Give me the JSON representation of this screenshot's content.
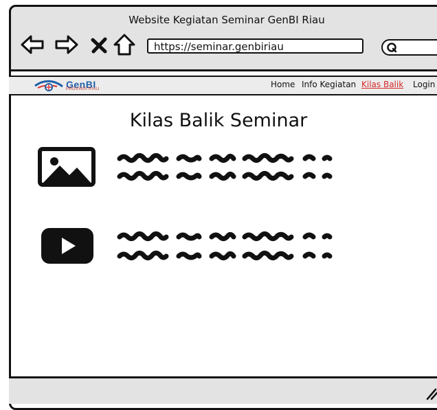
{
  "window": {
    "title": "Website Kegiatan Seminar GenBI Riau"
  },
  "browser": {
    "url": "https://seminar.genbiriau",
    "back_icon": "arrow-left-icon",
    "forward_icon": "arrow-right-icon",
    "stop_icon": "close-icon",
    "home_icon": "home-icon",
    "search_icon": "search-icon"
  },
  "site": {
    "logo_text": "GenBI",
    "logo_subtext": "PROVINSI RIAU",
    "nav": [
      {
        "label": "Home",
        "active": false
      },
      {
        "label": "Info Kegiatan",
        "active": false
      },
      {
        "label": "Kilas Balik",
        "active": true
      },
      {
        "label": "Login",
        "active": false
      }
    ]
  },
  "main": {
    "heading": "Kilas Balik Seminar",
    "items": [
      {
        "icon": "image-icon"
      },
      {
        "icon": "video-play-icon"
      }
    ]
  },
  "colors": {
    "active_link": "#d62a2a",
    "chrome": "#e3e3e3"
  }
}
